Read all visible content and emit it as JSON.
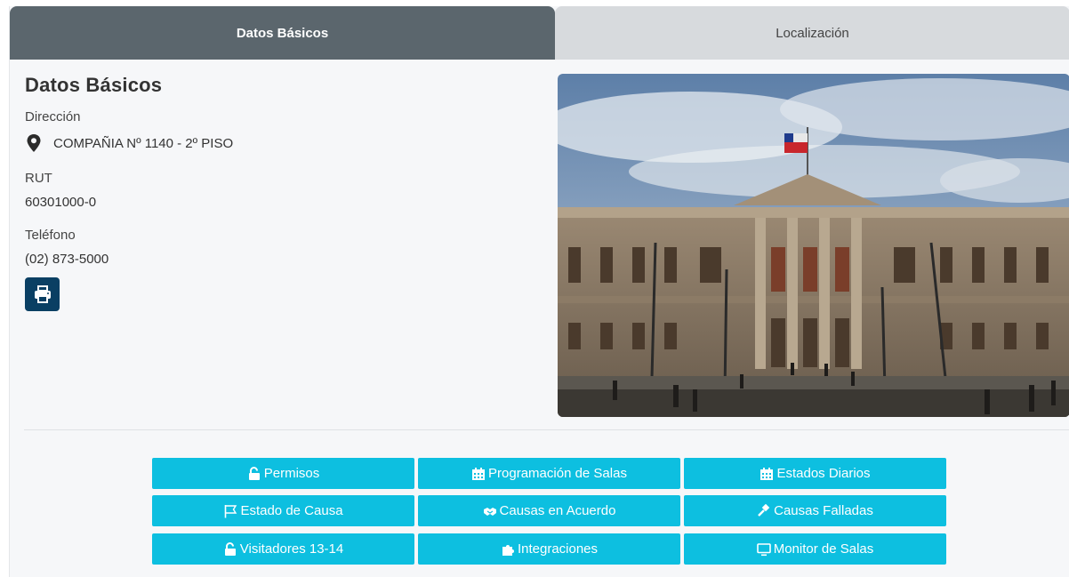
{
  "tabs": {
    "basic": "Datos Básicos",
    "location": "Localización"
  },
  "info": {
    "title": "Datos Básicos",
    "address_label": "Dirección",
    "address": "COMPAÑIA Nº 1140 - 2º PISO",
    "rut_label": "RUT",
    "rut": "60301000-0",
    "phone_label": "Teléfono",
    "phone": "(02) 873-5000",
    "print_icon": "print-icon"
  },
  "buttons": {
    "permisos": "Permisos",
    "programacion": "Programación de Salas",
    "estados_diarios": "Estados Diarios",
    "estado_causa": "Estado de Causa",
    "causas_acuerdo": "Causas en Acuerdo",
    "causas_falladas": "Causas Falladas",
    "visitadores": "Visitadores 13-14",
    "integraciones": "Integraciones",
    "monitor": "Monitor de Salas"
  },
  "colors": {
    "tab_active": "#5b666d",
    "tab_inactive": "#d7dadd",
    "accent": "#0dbfe0",
    "print": "#0a3f63"
  }
}
